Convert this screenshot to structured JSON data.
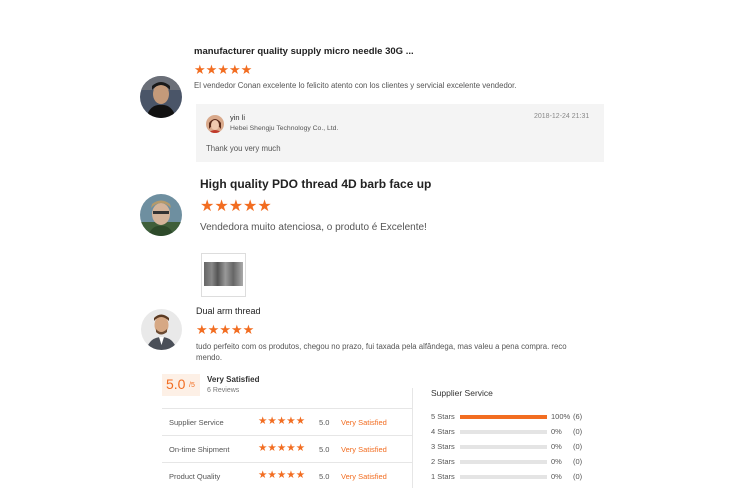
{
  "reviews": [
    {
      "product_title": "manufacturer quality supply micro needle 30G ...",
      "rating": 5,
      "text": "El vendedor Conan excelente lo felicito atento con los clientes y servicial excelente vendedor.",
      "reply": {
        "name": "yin li",
        "company": "Hebei Shengju Technology Co., Ltd.",
        "date": "2018-12-24 21:31",
        "text": "Thank you very much"
      }
    },
    {
      "product_title": "High quality PDO thread 4D barb face up",
      "rating": 5,
      "text": "Vendedora muito atenciosa, o produto é  Excelente!"
    },
    {
      "product_title": "Dual arm thread",
      "rating": 5,
      "text_line1": "tudo perfeito com os produtos, chegou no prazo, fui taxada pela alfândega, mas valeu a pena compra. reco",
      "text_line2": "mendo."
    }
  ],
  "summary": {
    "score": "5.0",
    "score_suffix": "/5",
    "label": "Very Satisfied",
    "reviews_count": "6 Reviews",
    "services": [
      {
        "name": "Supplier Service",
        "rating": 5,
        "score": "5.0",
        "label": "Very Satisfied"
      },
      {
        "name": "On-time Shipment",
        "rating": 5,
        "score": "5.0",
        "label": "Very Satisfied"
      },
      {
        "name": "Product Quality",
        "rating": 5,
        "score": "5.0",
        "label": "Very Satisfied"
      }
    ],
    "distribution_title": "Supplier Service",
    "distribution": [
      {
        "label": "5 Stars",
        "fraction": 1.0,
        "percent": "100%",
        "count": "(6)"
      },
      {
        "label": "4 Stars",
        "fraction": 0.0,
        "percent": "0%",
        "count": "(0)"
      },
      {
        "label": "3 Stars",
        "fraction": 0.0,
        "percent": "0%",
        "count": "(0)"
      },
      {
        "label": "2 Stars",
        "fraction": 0.0,
        "percent": "0%",
        "count": "(0)"
      },
      {
        "label": "1 Stars",
        "fraction": 0.0,
        "percent": "0%",
        "count": "(0)"
      }
    ]
  },
  "colors": {
    "accent": "#f26d21",
    "reply_bg": "#f4f4f4",
    "score_bg": "#fdf0e6"
  },
  "icons": {
    "star": "star-icon"
  }
}
